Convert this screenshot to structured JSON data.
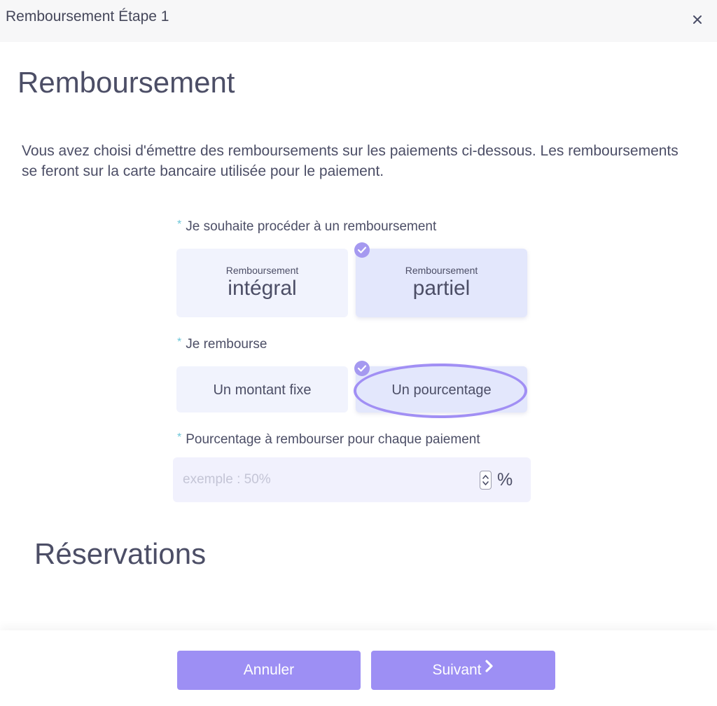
{
  "window": {
    "title": "Remboursement Étape 1",
    "close_icon": "close-icon"
  },
  "page": {
    "heading": "Remboursement",
    "intro": "Vous avez choisi d'émettre des remboursements sur les paiements ci-dessous. Les remboursements se feront sur la carte bancaire utilisée pour le paiement."
  },
  "refund_type": {
    "required_mark": "*",
    "label": "Je souhaite procéder à un remboursement",
    "options": [
      {
        "small": "Remboursement",
        "big": "intégral",
        "selected": false
      },
      {
        "small": "Remboursement",
        "big": "partiel",
        "selected": true
      }
    ]
  },
  "refund_mode": {
    "required_mark": "*",
    "label": "Je rembourse",
    "options": [
      {
        "label": "Un montant fixe",
        "selected": false
      },
      {
        "label": "Un pourcentage",
        "selected": true
      }
    ]
  },
  "percentage": {
    "required_mark": "*",
    "label": "Pourcentage à rembourser pour chaque paiement",
    "value": "",
    "placeholder": "exemple : 50%",
    "unit": "%"
  },
  "reservations": {
    "heading": "Réservations"
  },
  "footer": {
    "cancel_label": "Annuler",
    "next_label": "Suivant",
    "next_icon": "chevron-right-icon"
  },
  "colors": {
    "accent": "#9d8ff4",
    "highlight_ring": "#a18ff4",
    "option_bg": "#f1f3fd",
    "option_selected_bg": "#e3e7fc",
    "required_star": "#6cc6d8",
    "text": "#4c4e66"
  }
}
